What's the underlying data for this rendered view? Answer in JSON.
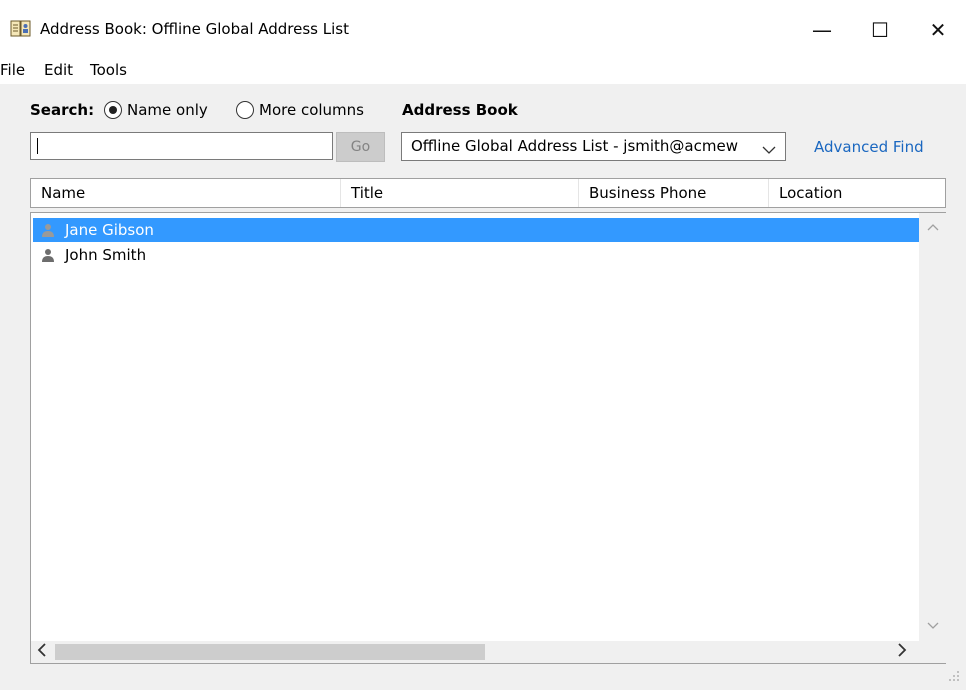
{
  "window": {
    "title": "Address Book: Offline Global Address List",
    "icon": "address-book-icon",
    "controls": {
      "minimize": "—",
      "maximize": "☐",
      "close": "✕"
    }
  },
  "menu": {
    "items": [
      "File",
      "Edit",
      "Tools"
    ]
  },
  "search": {
    "label": "Search:",
    "options": [
      {
        "label": "Name only",
        "selected": true
      },
      {
        "label": "More columns",
        "selected": false
      }
    ],
    "input_value": "",
    "go_label": "Go"
  },
  "address_book": {
    "label": "Address Book",
    "selected": "Offline Global Address List - jsmith@acmew",
    "chevron": "﹀"
  },
  "advanced_find": "Advanced Find",
  "list": {
    "columns": [
      "Name",
      "Title",
      "Business Phone",
      "Location"
    ],
    "rows": [
      {
        "name": "Jane Gibson",
        "selected": true
      },
      {
        "name": "John Smith",
        "selected": false
      }
    ]
  },
  "colors": {
    "selection": "#3399ff",
    "link": "#1a67c0"
  }
}
